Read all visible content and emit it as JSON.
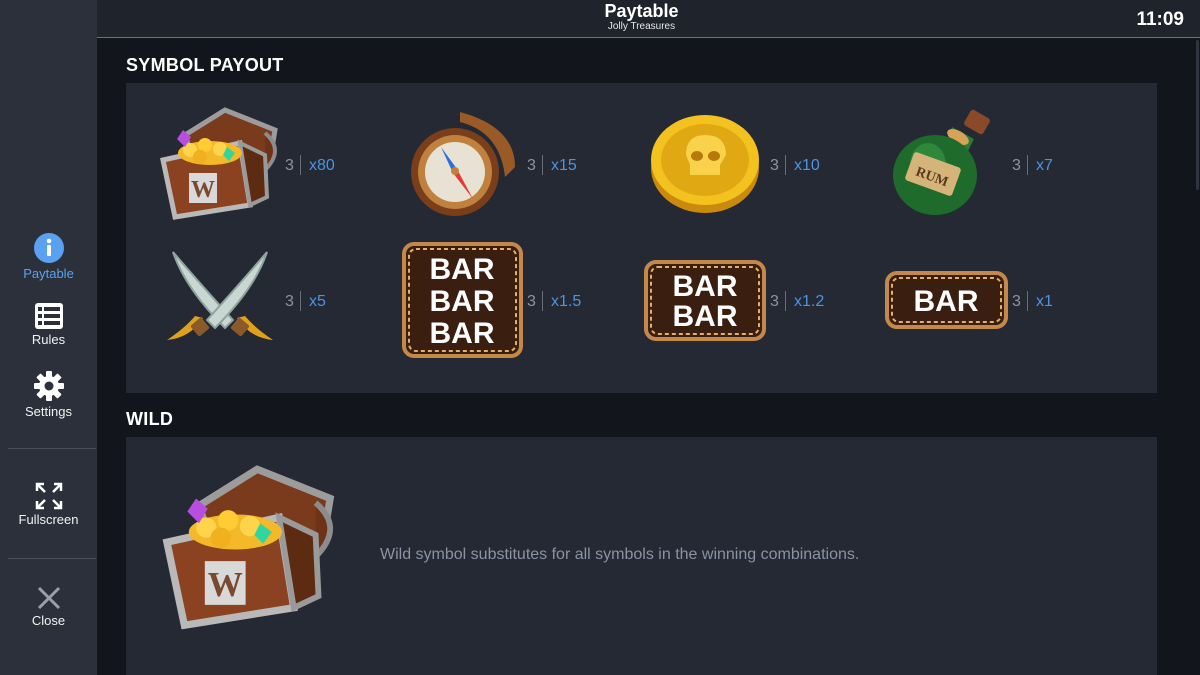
{
  "header": {
    "title": "Paytable",
    "subtitle": "Jolly Treasures",
    "clock": "11:09"
  },
  "sidebar": {
    "items": [
      {
        "label": "Paytable",
        "icon": "info-icon",
        "active": true
      },
      {
        "label": "Rules",
        "icon": "list-icon",
        "active": false
      },
      {
        "label": "Settings",
        "icon": "gear-icon",
        "active": false
      },
      {
        "label": "Fullscreen",
        "icon": "fullscreen-icon",
        "active": false
      },
      {
        "label": "Close",
        "icon": "close-icon",
        "active": false
      }
    ]
  },
  "symbol_payout": {
    "title": "SYMBOL PAYOUT",
    "symbols": [
      {
        "icon": "treasure-chest-wild-icon",
        "count": "3",
        "multiplier": "x80"
      },
      {
        "icon": "compass-icon",
        "count": "3",
        "multiplier": "x15"
      },
      {
        "icon": "skull-coin-icon",
        "count": "3",
        "multiplier": "x10"
      },
      {
        "icon": "rum-bottle-icon",
        "count": "3",
        "multiplier": "x7"
      },
      {
        "icon": "crossed-swords-icon",
        "count": "3",
        "multiplier": "x5"
      },
      {
        "icon": "triple-bar-icon",
        "count": "3",
        "multiplier": "x1.5"
      },
      {
        "icon": "double-bar-icon",
        "count": "3",
        "multiplier": "x1.2"
      },
      {
        "icon": "single-bar-icon",
        "count": "3",
        "multiplier": "x1"
      }
    ]
  },
  "bar_text": "BAR",
  "chest_letter": "W",
  "rum_text": "RUM",
  "wild": {
    "title": "WILD",
    "icon": "treasure-chest-wild-icon",
    "description": "Wild symbol substitutes for all symbols in the winning combinations."
  },
  "colors": {
    "accent": "#4f93e0",
    "sidebar": "#2b303b",
    "panel": "#242934",
    "background": "#12151c"
  }
}
